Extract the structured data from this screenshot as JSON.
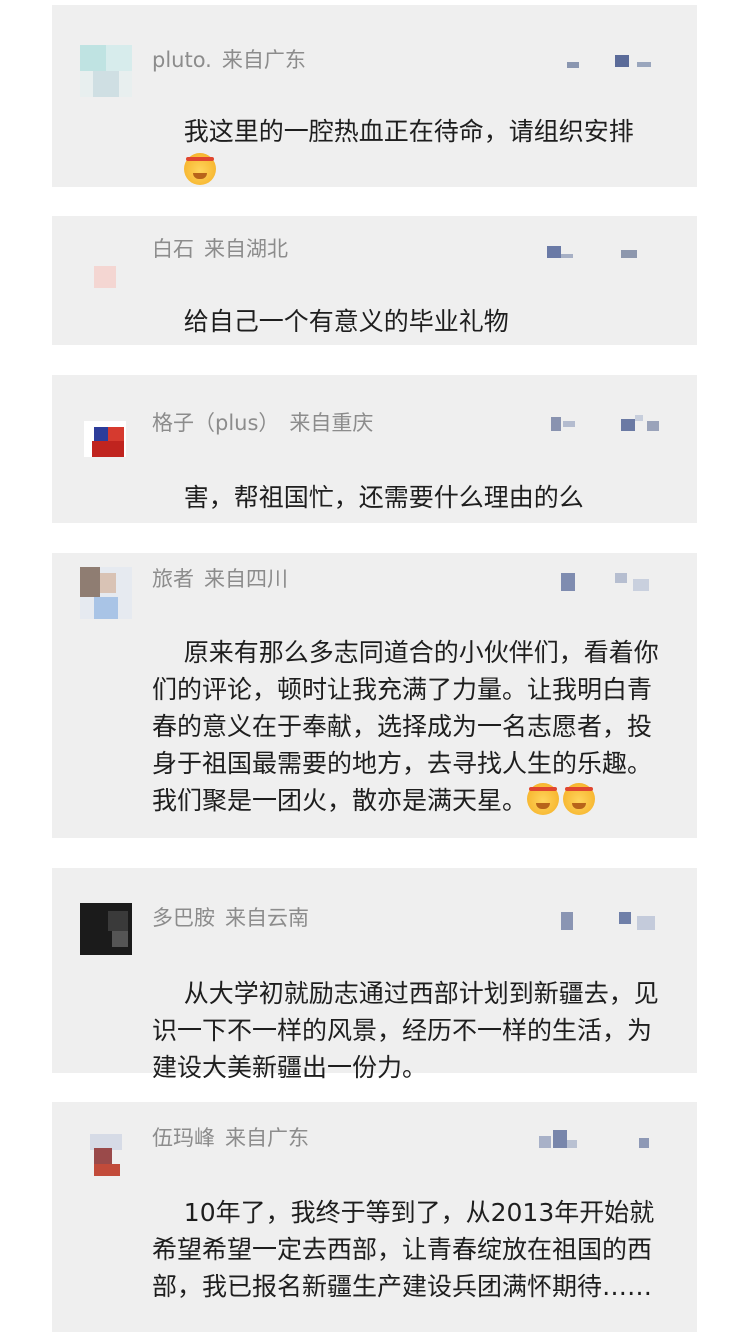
{
  "comments": [
    {
      "name": "pluto.",
      "location": "来自广东",
      "text": "我这里的一腔热血正在待命，请组织安排",
      "emoji_count": 1,
      "emoji": "salute-emoji"
    },
    {
      "name": "白石",
      "location": "来自湖北",
      "text": "给自己一个有意义的毕业礼物",
      "emoji_count": 0
    },
    {
      "name": "格子（plus）",
      "location": "来自重庆",
      "text": "害，帮祖国忙，还需要什么理由的么",
      "emoji_count": 0
    },
    {
      "name": "旅者",
      "location": "来自四川",
      "text": "原来有那么多志同道合的小伙伴们，看着你们的评论，顿时让我充满了力量。让我明白青春的意义在于奉献，选择成为一名志愿者，投身于祖国最需要的地方，去寻找人生的乐趣。我们聚是一团火，散亦是满天星。",
      "emoji_count": 2,
      "emoji": "salute-emoji"
    },
    {
      "name": "多巴胺",
      "location": "来自云南",
      "text": "从大学初就励志通过西部计划到新疆去，见识一下不一样的风景，经历不一样的生活，为建设大美新疆出一份力。",
      "emoji_count": 0
    },
    {
      "name": "伍玛峰",
      "location": "来自广东",
      "text": "10年了，我终于等到了，从2013年开始就希望希望一定去西部，让青春绽放在祖国的西部，我已报名新疆生产建设兵团满怀期待……",
      "emoji_count": 0
    }
  ]
}
